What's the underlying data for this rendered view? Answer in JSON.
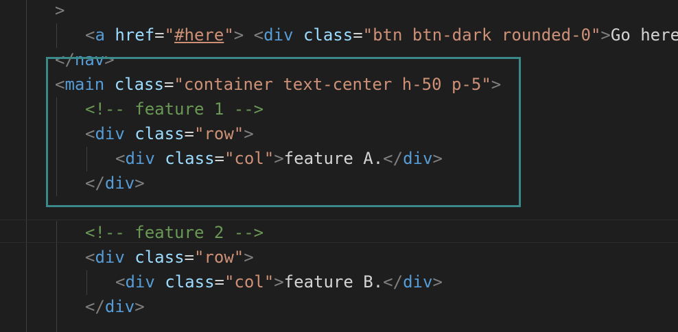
{
  "editor": {
    "lines": [
      {
        "id": "l1",
        "tokens": [
          {
            "t": "punct",
            "v": ">"
          }
        ]
      },
      {
        "id": "l2",
        "tokens": [
          {
            "t": "punct",
            "v": "<"
          },
          {
            "t": "tag",
            "v": "a"
          },
          {
            "t": "text",
            "v": " "
          },
          {
            "t": "attr",
            "v": "href"
          },
          {
            "t": "eq",
            "v": "="
          },
          {
            "t": "str",
            "v": "\""
          },
          {
            "t": "str-link",
            "v": "#here"
          },
          {
            "t": "str",
            "v": "\""
          },
          {
            "t": "punct",
            "v": ">"
          },
          {
            "t": "text",
            "v": " "
          },
          {
            "t": "punct",
            "v": "<"
          },
          {
            "t": "tag",
            "v": "div"
          },
          {
            "t": "text",
            "v": " "
          },
          {
            "t": "attr",
            "v": "class"
          },
          {
            "t": "eq",
            "v": "="
          },
          {
            "t": "str",
            "v": "\"btn btn-dark rounded-0\""
          },
          {
            "t": "punct",
            "v": ">"
          },
          {
            "t": "text",
            "v": "Go here"
          }
        ]
      },
      {
        "id": "l3",
        "tokens": [
          {
            "t": "punct",
            "v": "</"
          },
          {
            "t": "tag",
            "v": "nav"
          },
          {
            "t": "punct",
            "v": ">"
          }
        ]
      },
      {
        "id": "l4",
        "tokens": [
          {
            "t": "punct",
            "v": "<"
          },
          {
            "t": "tag",
            "v": "main"
          },
          {
            "t": "text",
            "v": " "
          },
          {
            "t": "attr",
            "v": "class"
          },
          {
            "t": "eq",
            "v": "="
          },
          {
            "t": "str",
            "v": "\"container text-center h-50 p-5\""
          },
          {
            "t": "punct",
            "v": ">"
          }
        ]
      },
      {
        "id": "l5",
        "tokens": [
          {
            "t": "comment",
            "v": "<!-- feature 1 -->"
          }
        ]
      },
      {
        "id": "l6",
        "tokens": [
          {
            "t": "punct",
            "v": "<"
          },
          {
            "t": "tag",
            "v": "div"
          },
          {
            "t": "text",
            "v": " "
          },
          {
            "t": "attr",
            "v": "class"
          },
          {
            "t": "eq",
            "v": "="
          },
          {
            "t": "str",
            "v": "\"row\""
          },
          {
            "t": "punct",
            "v": ">"
          }
        ]
      },
      {
        "id": "l7",
        "tokens": [
          {
            "t": "punct",
            "v": "<"
          },
          {
            "t": "tag",
            "v": "div"
          },
          {
            "t": "text",
            "v": " "
          },
          {
            "t": "attr",
            "v": "class"
          },
          {
            "t": "eq",
            "v": "="
          },
          {
            "t": "str",
            "v": "\"col\""
          },
          {
            "t": "punct",
            "v": ">"
          },
          {
            "t": "text",
            "v": "feature A."
          },
          {
            "t": "punct",
            "v": "</"
          },
          {
            "t": "tag",
            "v": "div"
          },
          {
            "t": "punct",
            "v": ">"
          }
        ]
      },
      {
        "id": "l8",
        "tokens": [
          {
            "t": "punct",
            "v": "</"
          },
          {
            "t": "tag",
            "v": "div"
          },
          {
            "t": "punct",
            "v": ">"
          }
        ]
      },
      {
        "id": "l9",
        "tokens": []
      },
      {
        "id": "l10",
        "tokens": [
          {
            "t": "comment",
            "v": "<!-- feature 2 -->"
          }
        ]
      },
      {
        "id": "l11",
        "tokens": [
          {
            "t": "punct",
            "v": "<"
          },
          {
            "t": "tag",
            "v": "div"
          },
          {
            "t": "text",
            "v": " "
          },
          {
            "t": "attr",
            "v": "class"
          },
          {
            "t": "eq",
            "v": "="
          },
          {
            "t": "str",
            "v": "\"row\""
          },
          {
            "t": "punct",
            "v": ">"
          }
        ]
      },
      {
        "id": "l12",
        "tokens": [
          {
            "t": "punct",
            "v": "<"
          },
          {
            "t": "tag",
            "v": "div"
          },
          {
            "t": "text",
            "v": " "
          },
          {
            "t": "attr",
            "v": "class"
          },
          {
            "t": "eq",
            "v": "="
          },
          {
            "t": "str",
            "v": "\"col\""
          },
          {
            "t": "punct",
            "v": ">"
          },
          {
            "t": "text",
            "v": "feature B."
          },
          {
            "t": "punct",
            "v": "</"
          },
          {
            "t": "tag",
            "v": "div"
          },
          {
            "t": "punct",
            "v": ">"
          }
        ]
      },
      {
        "id": "l13",
        "tokens": [
          {
            "t": "punct",
            "v": "</"
          },
          {
            "t": "tag",
            "v": "div"
          },
          {
            "t": "punct",
            "v": ">"
          }
        ]
      }
    ]
  },
  "colors": {
    "background": "#1e1e1e",
    "tag": "#569cd6",
    "attribute": "#9cdcfe",
    "string": "#ce9178",
    "comment": "#6a9955",
    "highlight_box": "#3b8a8a"
  }
}
